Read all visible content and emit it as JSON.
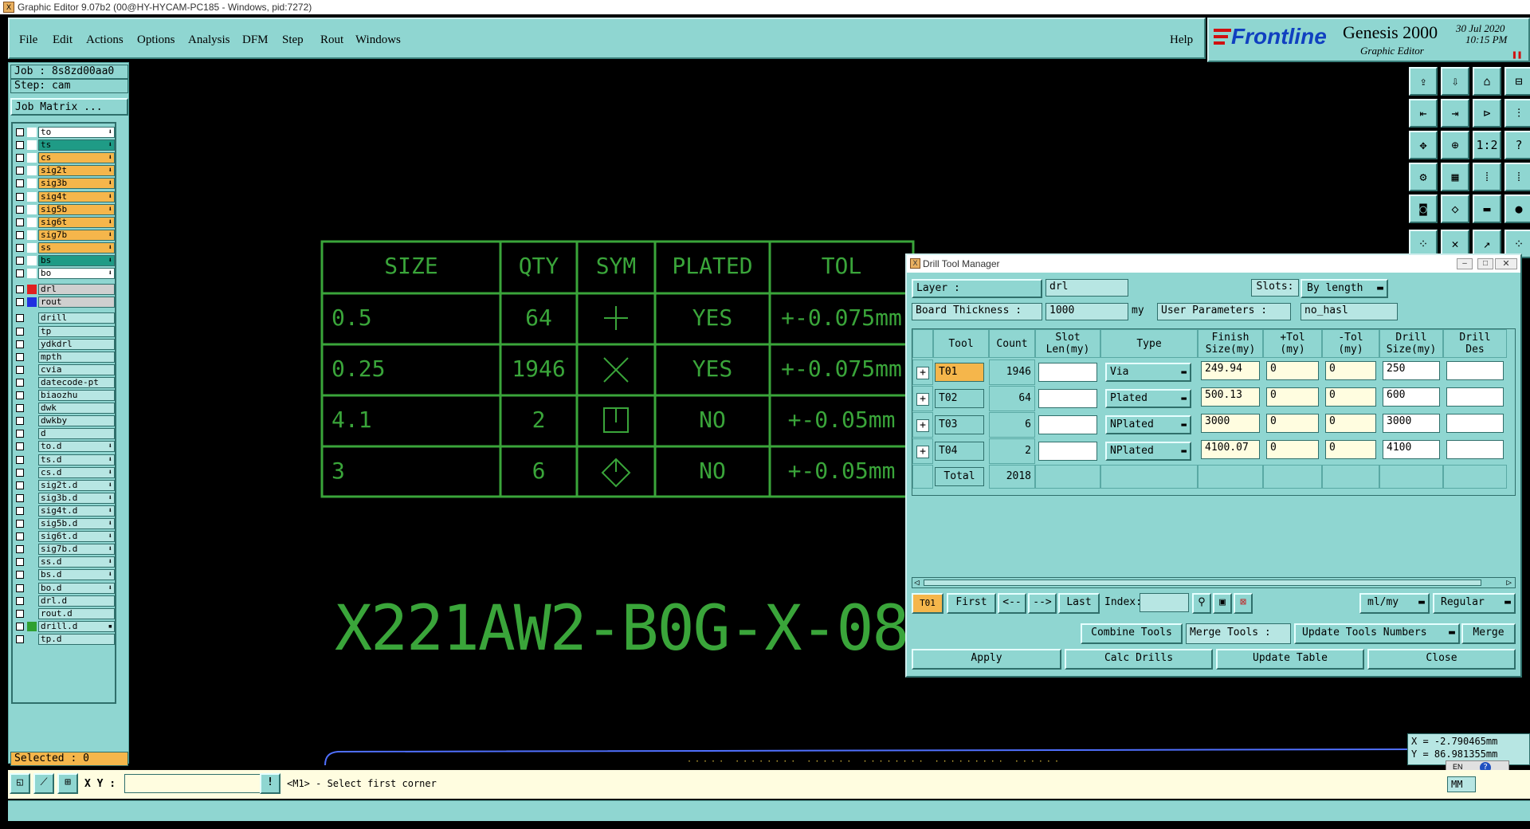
{
  "window": {
    "title": "Graphic Editor 9.07b2 (00@HY-HYCAM-PC185 - Windows, pid:7272)"
  },
  "menu": {
    "file": "File",
    "edit": "Edit",
    "actions": "Actions",
    "options": "Options",
    "analysis": "Analysis",
    "dfm": "DFM",
    "step": "Step",
    "rout": "Rout",
    "windows": "Windows",
    "help": "Help"
  },
  "brand": {
    "logo": "Frontline",
    "product": "Genesis 2000",
    "subtitle": "Graphic Editor",
    "date": "30 Jul 2020",
    "time": "10:15 PM"
  },
  "left": {
    "job": "Job : 8s8zd00aa0",
    "step": "Step: cam",
    "job_matrix": "Job Matrix ...",
    "selected": "Selected : 0",
    "layers": [
      {
        "name": "to",
        "color": "#ffffff",
        "bg": "#ffffff",
        "arrow": "⬇"
      },
      {
        "name": "ts",
        "color": "#ffffff",
        "bg": "#1f9b86",
        "arrow": "⬇"
      },
      {
        "name": "cs",
        "color": "#ffffff",
        "bg": "#f5b64b",
        "arrow": "⬇"
      },
      {
        "name": "sig2t",
        "color": "#ffffff",
        "bg": "#f5b64b",
        "arrow": "⬇"
      },
      {
        "name": "sig3b",
        "color": "#ffffff",
        "bg": "#f5b64b",
        "arrow": "⬇"
      },
      {
        "name": "sig4t",
        "color": "#ffffff",
        "bg": "#f5b64b",
        "arrow": "⬇"
      },
      {
        "name": "sig5b",
        "color": "#ffffff",
        "bg": "#f5b64b",
        "arrow": "⬇"
      },
      {
        "name": "sig6t",
        "color": "#ffffff",
        "bg": "#f5b64b",
        "arrow": "⬇"
      },
      {
        "name": "sig7b",
        "color": "#ffffff",
        "bg": "#f5b64b",
        "arrow": "⬇"
      },
      {
        "name": "ss",
        "color": "#ffffff",
        "bg": "#f5b64b",
        "arrow": "⬇"
      },
      {
        "name": "bs",
        "color": "#ffffff",
        "bg": "#1f9b86",
        "arrow": "⬇"
      },
      {
        "name": "bo",
        "color": "#ffffff",
        "bg": "#ffffff",
        "arrow": "⬇"
      },
      {
        "name": "drl",
        "color": "#e02020",
        "bg": "#cfcfcf",
        "arrow": ""
      },
      {
        "name": "rout",
        "color": "#2030e0",
        "bg": "#cfcfcf",
        "arrow": ""
      },
      {
        "name": "drill",
        "color": "",
        "bg": "#b7e6e3",
        "arrow": ""
      },
      {
        "name": "tp",
        "color": "",
        "bg": "#b7e6e3",
        "arrow": ""
      },
      {
        "name": "ydkdrl",
        "color": "",
        "bg": "#b7e6e3",
        "arrow": ""
      },
      {
        "name": "mpth",
        "color": "",
        "bg": "#b7e6e3",
        "arrow": ""
      },
      {
        "name": "cvia",
        "color": "",
        "bg": "#b7e6e3",
        "arrow": ""
      },
      {
        "name": "datecode-pt",
        "color": "",
        "bg": "#b7e6e3",
        "arrow": ""
      },
      {
        "name": "biaozhu",
        "color": "",
        "bg": "#b7e6e3",
        "arrow": ""
      },
      {
        "name": "dwk",
        "color": "",
        "bg": "#b7e6e3",
        "arrow": ""
      },
      {
        "name": "dwkby",
        "color": "",
        "bg": "#b7e6e3",
        "arrow": ""
      },
      {
        "name": "d",
        "color": "",
        "bg": "#b7e6e3",
        "arrow": ""
      },
      {
        "name": "to.d",
        "color": "",
        "bg": "#b7e6e3",
        "arrow": "⬇"
      },
      {
        "name": "ts.d",
        "color": "",
        "bg": "#b7e6e3",
        "arrow": "⬇"
      },
      {
        "name": "cs.d",
        "color": "",
        "bg": "#b7e6e3",
        "arrow": "⬇"
      },
      {
        "name": "sig2t.d",
        "color": "",
        "bg": "#b7e6e3",
        "arrow": "⬇"
      },
      {
        "name": "sig3b.d",
        "color": "",
        "bg": "#b7e6e3",
        "arrow": "⬇"
      },
      {
        "name": "sig4t.d",
        "color": "",
        "bg": "#b7e6e3",
        "arrow": "⬇"
      },
      {
        "name": "sig5b.d",
        "color": "",
        "bg": "#b7e6e3",
        "arrow": "⬇"
      },
      {
        "name": "sig6t.d",
        "color": "",
        "bg": "#b7e6e3",
        "arrow": "⬇"
      },
      {
        "name": "sig7b.d",
        "color": "",
        "bg": "#b7e6e3",
        "arrow": "⬇"
      },
      {
        "name": "ss.d",
        "color": "",
        "bg": "#b7e6e3",
        "arrow": "⬇"
      },
      {
        "name": "bs.d",
        "color": "",
        "bg": "#b7e6e3",
        "arrow": "⬇"
      },
      {
        "name": "bo.d",
        "color": "",
        "bg": "#b7e6e3",
        "arrow": "⬇"
      },
      {
        "name": "drl.d",
        "color": "",
        "bg": "#b7e6e3",
        "arrow": ""
      },
      {
        "name": "rout.d",
        "color": "",
        "bg": "#b7e6e3",
        "arrow": ""
      },
      {
        "name": "drill.d",
        "color": "#30a030",
        "bg": "#b7e6e3",
        "arrow": "▪"
      },
      {
        "name": "tp.d",
        "color": "",
        "bg": "#b7e6e3",
        "arrow": ""
      }
    ]
  },
  "canvas": {
    "table_headers": [
      "SIZE",
      "QTY",
      "SYM",
      "PLATED",
      "TOL"
    ],
    "table_rows": [
      [
        "0.5",
        "64",
        "plus-symbol",
        "YES",
        "+-0.075mm"
      ],
      [
        "0.25",
        "1946",
        "cross-symbol",
        "YES",
        "+-0.075mm"
      ],
      [
        "4.1",
        "2",
        "square-symbol",
        "NO",
        "+-0.05mm"
      ],
      [
        "3",
        "6",
        "diamond-symbol",
        "NO",
        "+-0.05mm"
      ]
    ],
    "part_number": "X221AW2-B0G-X-08",
    "coord_x": "X = -2.790465mm",
    "coord_y": "Y = 86.981355mm",
    "lang": "EN"
  },
  "dtm": {
    "title": "Drill Tool Manager",
    "layer_label": "Layer :",
    "layer_value": "drl",
    "slots_label": "Slots:",
    "slots_value": "By length",
    "thickness_label": "Board Thickness :",
    "thickness_value": "1000",
    "thickness_unit": "my",
    "user_params_label": "User Parameters :",
    "user_params_value": "no_hasl",
    "headers": {
      "tool": "Tool",
      "count": "Count",
      "slot1": "Slot",
      "slot2": "Len(my)",
      "type": "Type",
      "finish1": "Finish",
      "finish2": "Size(my)",
      "ptol1": "+Tol",
      "ptol2": "(my)",
      "ntol1": "-Tol",
      "ntol2": "(my)",
      "drill1": "Drill",
      "drill2": "Size(my)",
      "des1": "Drill",
      "des2": "Des"
    },
    "rows": [
      {
        "tool": "T01",
        "count": "1946",
        "type": "Via",
        "finish": "249.94",
        "ptol": "0",
        "ntol": "0",
        "drill": "250"
      },
      {
        "tool": "T02",
        "count": "64",
        "type": "Plated",
        "finish": "500.13",
        "ptol": "0",
        "ntol": "0",
        "drill": "600"
      },
      {
        "tool": "T03",
        "count": "6",
        "type": "NPlated",
        "finish": "3000",
        "ptol": "0",
        "ntol": "0",
        "drill": "3000"
      },
      {
        "tool": "T04",
        "count": "2",
        "type": "NPlated",
        "finish": "4100.07",
        "ptol": "0",
        "ntol": "0",
        "drill": "4100"
      }
    ],
    "total_label": "Total",
    "total_value": "2018",
    "nav": {
      "current": "T01",
      "first": "First",
      "prev": "<--",
      "next": "-->",
      "last": "Last",
      "index": "Index:",
      "units": "ml/my",
      "mode": "Regular"
    },
    "buttons": {
      "combine": "Combine Tools",
      "merge_tools": "Merge Tools :",
      "update_numbers": "Update Tools Numbers",
      "merge": "Merge",
      "apply": "Apply",
      "calc": "Calc Drills",
      "update_table": "Update Table",
      "close": "Close"
    }
  },
  "status": {
    "xy_label": "X Y :",
    "prompt": "<M1> - Select first corner",
    "units": "MM"
  }
}
